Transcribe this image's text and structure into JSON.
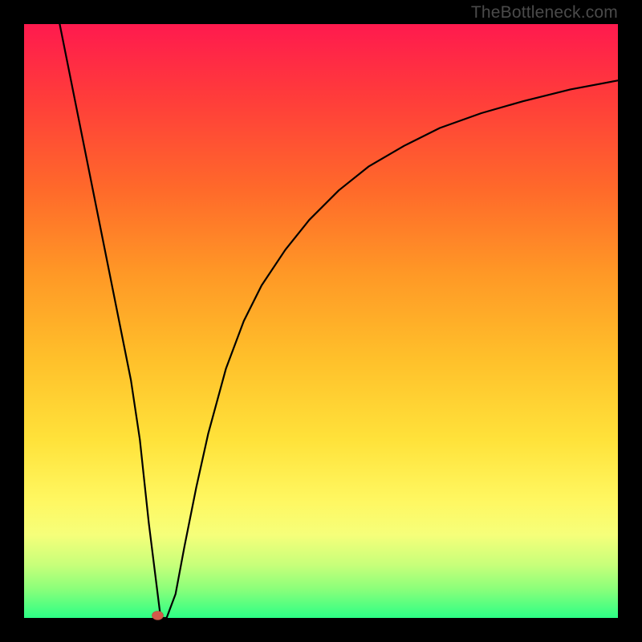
{
  "watermark": "TheBottleneck.com",
  "chart_data": {
    "type": "line",
    "title": "",
    "xlabel": "",
    "ylabel": "",
    "xlim": [
      0,
      100
    ],
    "ylim": [
      0,
      100
    ],
    "marker": {
      "x": 22.5,
      "y": 0,
      "color": "#d45a4a"
    },
    "series": [
      {
        "name": "curve",
        "x": [
          6,
          8,
          10,
          12,
          14,
          16,
          18,
          19.5,
          21,
          23,
          24,
          25.5,
          27,
          29,
          31,
          34,
          37,
          40,
          44,
          48,
          53,
          58,
          64,
          70,
          77,
          84,
          92,
          100
        ],
        "y": [
          100,
          90,
          80,
          70,
          60,
          50,
          40,
          30,
          16,
          0,
          0,
          4,
          12,
          22,
          31,
          42,
          50,
          56,
          62,
          67,
          72,
          76,
          79.5,
          82.5,
          85,
          87,
          89,
          90.5
        ]
      }
    ],
    "background_gradient": {
      "top": "#ff1a4e",
      "middle": "#ffe23a",
      "bottom": "#2cff85"
    }
  }
}
